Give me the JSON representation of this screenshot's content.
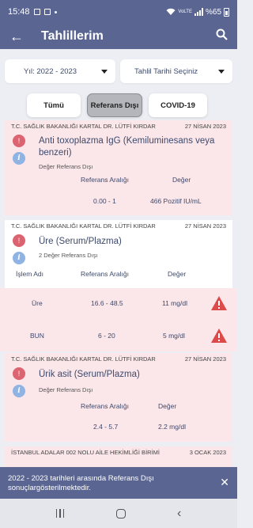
{
  "status_bar": {
    "time": "15:48",
    "network": "VoLTE",
    "battery": "%65"
  },
  "app_bar": {
    "title": "Tahlillerim",
    "back_icon": "arrow-left-icon",
    "search_icon": "search-icon"
  },
  "filters": {
    "year_select": "Yıl: 2022 - 2023",
    "date_select": "Tahlil Tarihi Seçiniz"
  },
  "tabs": [
    {
      "label": "Tümü",
      "selected": false
    },
    {
      "label": "Referans Dışı",
      "selected": true
    },
    {
      "label": "COVID-19",
      "selected": false
    }
  ],
  "results": [
    {
      "hospital": "T.C. SAĞLIK BAKANLIĞI KARTAL DR. LÜTFİ KIRDAR",
      "date": "27 NİSAN 2023",
      "name": "Anti toxoplazma IgG (Kemiluminesans veya benzeri)",
      "subtitle": "Değer Referans Dışı",
      "columns": [
        "Referans Aralığı",
        "Değer"
      ],
      "rows": [
        {
          "range": "0.00 - 1",
          "value": "466 Pozitif IU/mL"
        }
      ]
    },
    {
      "hospital": "T.C. SAĞLIK BAKANLIĞI KARTAL DR. LÜTFİ KIRDAR",
      "date": "27 NİSAN 2023",
      "name": "Üre (Serum/Plazma)",
      "subtitle": "2 Değer Referans Dışı",
      "columns": [
        "İşlem Adı",
        "Referans Aralığı",
        "Değer"
      ],
      "rows": [
        {
          "label": "Üre",
          "range": "16.6 - 48.5",
          "value": "11 mg/dl"
        },
        {
          "label": "BUN",
          "range": "6 - 20",
          "value": "5 mg/dl"
        }
      ]
    },
    {
      "hospital": "T.C. SAĞLIK BAKANLIĞI KARTAL DR. LÜTFİ KIRDAR",
      "date": "27 NİSAN 2023",
      "name": "Ürik asit (Serum/Plazma)",
      "subtitle": "Değer Referans Dışı",
      "columns": [
        "Referans Aralığı",
        "Değer"
      ],
      "rows": [
        {
          "range": "2.4 - 5.7",
          "value": "2.2 mg/dl"
        }
      ]
    },
    {
      "hospital": "İSTANBUL ADALAR 002 NOLU AİLE HEKİMLİĞİ BİRİMİ",
      "date": "3 OCAK 2023"
    }
  ],
  "snackbar": {
    "message": "2022 - 2023 tarihleri arasında Referans Dışı sonuçlargösterilmektedir.",
    "close_icon": "close-icon"
  },
  "colors": {
    "primary": "#5a6591",
    "out_of_range_bg": "#fbe6ea",
    "alert_red": "#dc4a4a",
    "info_blue": "#8fb3e3"
  }
}
